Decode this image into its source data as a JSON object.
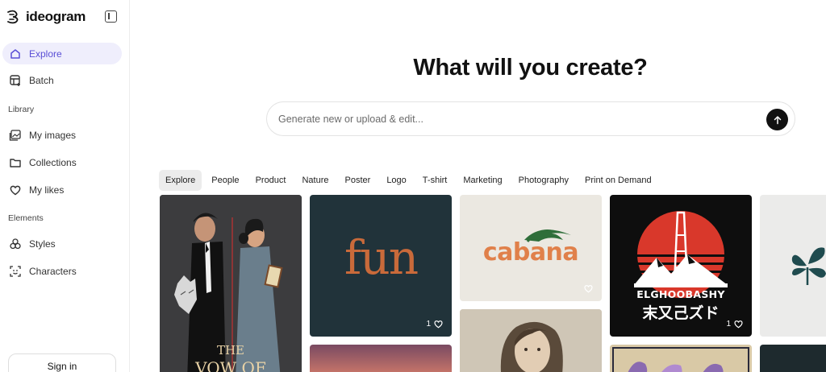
{
  "app": {
    "brand": "ideogram"
  },
  "sidebar": {
    "items": [
      {
        "label": "Explore",
        "icon": "home-icon",
        "active": true
      },
      {
        "label": "Batch",
        "icon": "batch-icon"
      }
    ],
    "library_label": "Library",
    "library_items": [
      {
        "label": "My images",
        "icon": "images-icon"
      },
      {
        "label": "Collections",
        "icon": "folder-icon"
      },
      {
        "label": "My likes",
        "icon": "heart-icon"
      }
    ],
    "elements_label": "Elements",
    "element_items": [
      {
        "label": "Styles",
        "icon": "styles-icon"
      },
      {
        "label": "Characters",
        "icon": "characters-icon"
      }
    ],
    "signin_label": "Sign in"
  },
  "main": {
    "headline": "What will you create?",
    "prompt_placeholder": "Generate new or upload & edit...",
    "tabs": [
      "Explore",
      "People",
      "Product",
      "Nature",
      "Poster",
      "Logo",
      "T-shirt",
      "Marketing",
      "Photography",
      "Print on Demand"
    ],
    "active_tab": "Explore"
  },
  "gallery": {
    "cards": [
      {
        "name": "vow-poster",
        "text_line": "THE",
        "text_line2": "VOW OF"
      },
      {
        "name": "fun-logo",
        "text": "fun",
        "likes": "1"
      },
      {
        "name": "cabana-logo",
        "text": "cabana",
        "likes": ""
      },
      {
        "name": "elghoobashy-tee",
        "text": "ELGHOOBASHY",
        "subtext": "末又己ズド",
        "likes": "1"
      },
      {
        "name": "leaf-logo"
      },
      {
        "name": "sunset-card"
      },
      {
        "name": "portrait-photo"
      },
      {
        "name": "floral-print"
      },
      {
        "name": "dark-card"
      }
    ]
  },
  "colors": {
    "accent": "#5a4fd6",
    "active_bg": "#efeefc"
  }
}
